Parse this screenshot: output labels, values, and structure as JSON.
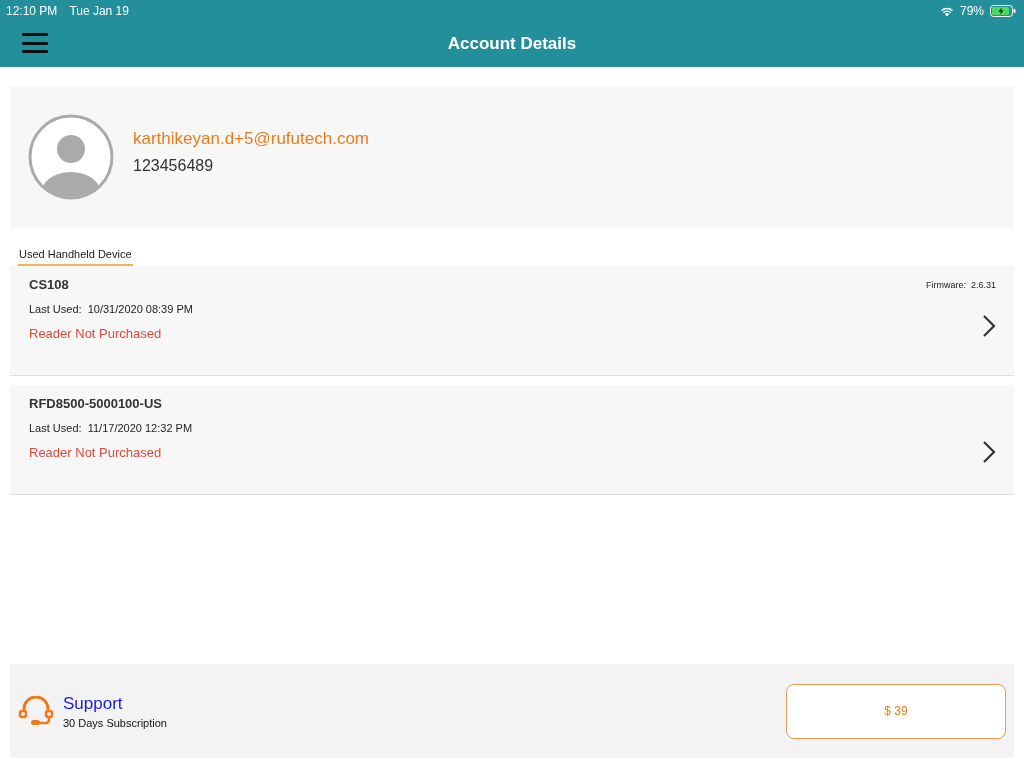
{
  "status_bar": {
    "time": "12:10 PM",
    "date": "Tue Jan 19",
    "battery": "79%",
    "charging": true
  },
  "nav": {
    "title": "Account Details"
  },
  "profile": {
    "email": "karthikeyan.d+5@rufutech.com",
    "phone": "123456489"
  },
  "tabs": [
    {
      "label": "Used Handheld Device",
      "selected": true
    }
  ],
  "devices": [
    {
      "name": "CS108",
      "firmware_label": "Firmware:",
      "firmware": "2.6.31",
      "last_used_label": "Last Used:",
      "last_used": "10/31/2020 08:39 PM",
      "status": "Reader Not Purchased"
    },
    {
      "name": "RFD8500-5000100-US",
      "last_used_label": "Last Used:",
      "last_used": "11/17/2020 12:32 PM",
      "status": "Reader Not Purchased"
    }
  ],
  "footer": {
    "support": "Support",
    "subscription": "30 Days Subscription",
    "price": "$ 39"
  }
}
